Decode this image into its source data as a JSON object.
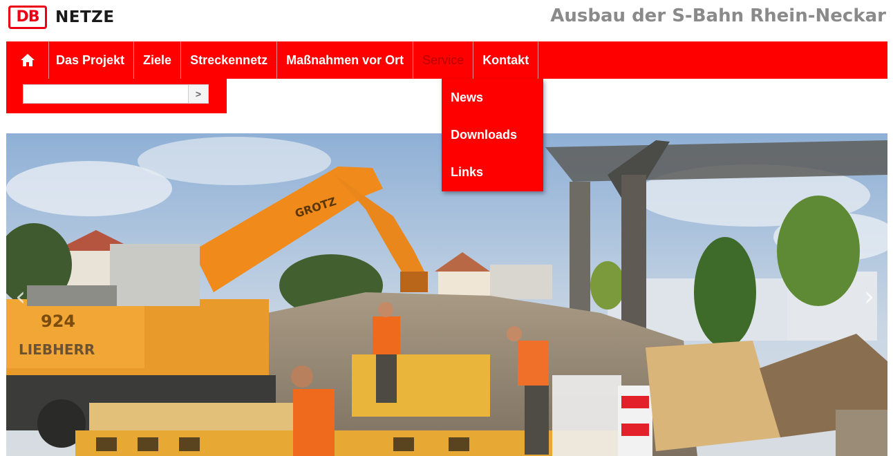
{
  "header": {
    "logo_db": "DB",
    "logo_netze": "NETZE",
    "site_title": "Ausbau der S-Bahn Rhein-Neckar"
  },
  "nav": {
    "home_icon": "home-icon",
    "items": [
      {
        "label": "Das Projekt"
      },
      {
        "label": "Ziele"
      },
      {
        "label": "Streckennetz"
      },
      {
        "label": "Maßnahmen vor Ort"
      },
      {
        "label": "Service",
        "active": true
      },
      {
        "label": "Kontakt"
      }
    ]
  },
  "search": {
    "value": "",
    "placeholder": "",
    "button_glyph": ">"
  },
  "dropdown": {
    "items": [
      {
        "label": "News"
      },
      {
        "label": "Downloads"
      },
      {
        "label": "Links"
      }
    ]
  },
  "hero": {
    "image_lettering": [
      "GROTZ",
      "924",
      "LIEBHERR"
    ],
    "prev_glyph": "‹",
    "next_glyph": "›"
  },
  "colors": {
    "brand_red": "#ff0000",
    "logo_red": "#ec0016",
    "title_gray": "#8a8a8a",
    "active_nav_text": "#b80000"
  }
}
